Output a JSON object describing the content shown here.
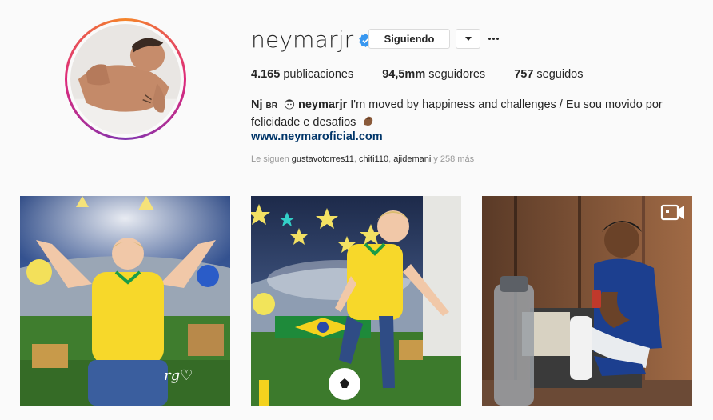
{
  "profile": {
    "username": "neymarjr",
    "follow_label": "Siguiendo",
    "stats": {
      "posts_count": "4.165",
      "posts_label": "publicaciones",
      "followers_count": "94,5mm",
      "followers_label": "seguidores",
      "following_count": "757",
      "following_label": "seguidos"
    },
    "bio": {
      "name": "Nj",
      "country": "BR",
      "handle": "neymarjr",
      "text": " I'm moved by happiness and challenges / Eu sou movido por felicidade e desafios",
      "link": "www.neymaroficial.com"
    },
    "followed_by": {
      "prefix": "Le siguen",
      "user1": "gustavotorres11",
      "user2": "chiti110",
      "user3": "ajidemani",
      "suffix": "y 258 más"
    }
  },
  "icons": {
    "verified": "verified-badge-icon",
    "dropdown": "chevron-down-icon",
    "more": "more-options-icon",
    "video": "video-icon",
    "emoji_hand": "flexed-hand-emoji",
    "emoji_face": "face-emoji"
  },
  "colors": {
    "background": "#fafafa",
    "link": "#003569",
    "verified": "#3897f0",
    "muted": "#999999"
  }
}
